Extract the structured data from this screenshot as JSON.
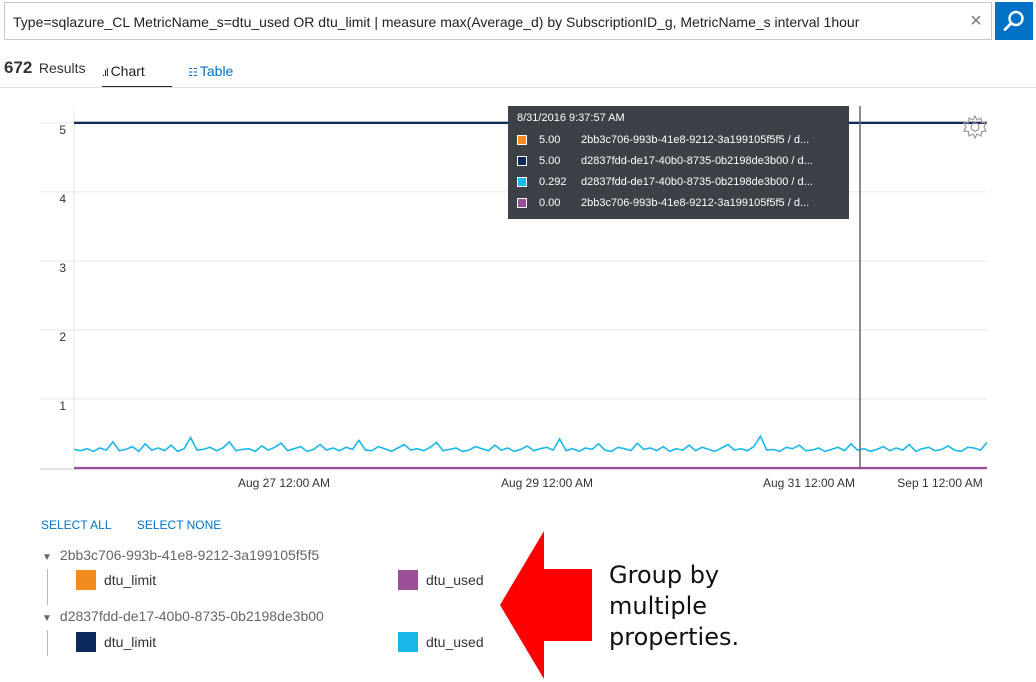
{
  "search": {
    "query": "Type=sqlazure_CL MetricName_s=dtu_used OR dtu_limit | measure max(Average_d) by SubscriptionID_g, MetricName_s interval 1hour",
    "clear_glyph": "×"
  },
  "results": {
    "count": "672",
    "label": "Results"
  },
  "tabs": [
    {
      "label": "Chart",
      "active": true,
      "icon": "bar-chart-icon"
    },
    {
      "label": "Table",
      "active": false,
      "icon": "table-icon"
    }
  ],
  "chart_data": {
    "type": "line",
    "y_ticks": [
      "1",
      "2",
      "3",
      "4",
      "5"
    ],
    "x_tick_labels": [
      "Aug 27 12:00 AM",
      "Aug 29 12:00 AM",
      "Aug 31 12:00 AM",
      "Sep 1 12:00 AM"
    ],
    "ylim": [
      0,
      5.1
    ],
    "grid": true,
    "cursor_time": "8/31/2016 9:37:57 AM",
    "series": [
      {
        "color": "#f28c1e",
        "values": [
          5,
          5
        ]
      },
      {
        "color": "#0d2a5c",
        "values": [
          5,
          5
        ]
      },
      {
        "color": "#9b4f96",
        "values": [
          0,
          0
        ]
      },
      {
        "color": "#1ab7ea",
        "values": [
          0.27,
          0.25,
          0.28,
          0.24,
          0.29,
          0.26,
          0.38,
          0.25,
          0.27,
          0.31,
          0.24,
          0.35,
          0.26,
          0.29,
          0.25,
          0.33,
          0.24,
          0.28,
          0.44,
          0.26,
          0.27,
          0.3,
          0.25,
          0.29,
          0.38,
          0.25,
          0.27,
          0.28,
          0.24,
          0.32,
          0.26,
          0.3,
          0.36,
          0.25,
          0.28,
          0.31,
          0.24,
          0.27,
          0.34,
          0.26,
          0.29,
          0.25,
          0.3,
          0.27,
          0.4,
          0.26,
          0.25,
          0.31,
          0.28,
          0.24,
          0.29,
          0.34,
          0.26,
          0.28,
          0.25,
          0.3,
          0.37,
          0.25,
          0.27,
          0.29,
          0.24,
          0.26,
          0.31,
          0.28,
          0.25,
          0.33,
          0.26,
          0.29,
          0.24,
          0.27,
          0.32,
          0.25,
          0.28,
          0.3,
          0.26,
          0.42,
          0.25,
          0.28,
          0.24,
          0.29,
          0.27,
          0.35,
          0.26,
          0.24,
          0.3,
          0.28,
          0.25,
          0.36,
          0.27,
          0.29,
          0.25,
          0.31,
          0.24,
          0.28,
          0.26,
          0.33,
          0.25,
          0.3,
          0.27,
          0.24,
          0.29,
          0.34,
          0.26,
          0.28,
          0.25,
          0.31,
          0.46,
          0.26,
          0.27,
          0.24,
          0.3,
          0.28,
          0.33,
          0.25,
          0.26,
          0.29,
          0.24,
          0.27,
          0.3,
          0.25,
          0.35,
          0.26,
          0.28,
          0.24,
          0.27,
          0.31,
          0.25,
          0.29,
          0.26,
          0.34,
          0.24,
          0.28,
          0.3,
          0.25,
          0.27,
          0.32,
          0.26,
          0.24,
          0.3,
          0.29,
          0.26,
          0.37
        ]
      }
    ]
  },
  "tooltip": {
    "title": "8/31/2016 9:37:57 AM",
    "rows": [
      {
        "color": "#f28c1e",
        "value": "5.00",
        "name": "2bb3c706-993b-41e8-9212-3a199105f5f5 / d..."
      },
      {
        "color": "#0d2a5c",
        "value": "5.00",
        "name": "d2837fdd-de17-40b0-8735-0b2198de3b00 / d..."
      },
      {
        "color": "#1ab7ea",
        "value": "0.292",
        "name": "d2837fdd-de17-40b0-8735-0b2198de3b00 / d..."
      },
      {
        "color": "#9b4f96",
        "value": "0.00",
        "name": "2bb3c706-993b-41e8-9212-3a199105f5f5 / d..."
      }
    ]
  },
  "legend": {
    "select_all": "SELECT ALL",
    "select_none": "SELECT NONE",
    "groups": [
      {
        "name": "2bb3c706-993b-41e8-9212-3a199105f5f5",
        "items": [
          {
            "label": "dtu_limit",
            "color": "#f28c1e"
          },
          {
            "label": "dtu_used",
            "color": "#9b4f96"
          }
        ]
      },
      {
        "name": "d2837fdd-de17-40b0-8735-0b2198de3b00",
        "items": [
          {
            "label": "dtu_limit",
            "color": "#0d2a5c"
          },
          {
            "label": "dtu_used",
            "color": "#1ab7ea"
          }
        ]
      }
    ]
  },
  "annotation": {
    "lines": [
      "Group by",
      "multiple",
      "properties."
    ],
    "arrow_color": "#ff0000"
  }
}
